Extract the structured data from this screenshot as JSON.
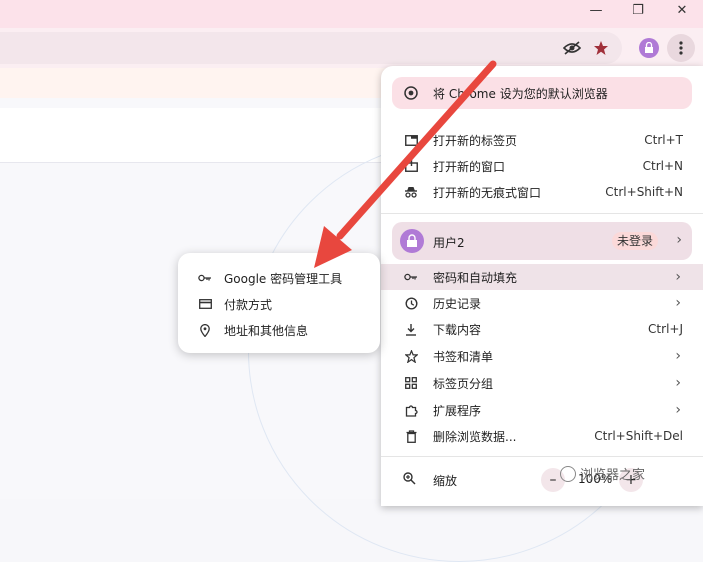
{
  "window": {
    "minimize": "—",
    "maximize": "❐",
    "close": "✕"
  },
  "toolbar": {
    "icons": [
      "eye-off-icon",
      "star-icon",
      "profile-avatar",
      "kebab-icon"
    ]
  },
  "menu": {
    "promo": "将 Chrome 设为您的默认浏览器",
    "new_tab": {
      "label": "打开新的标签页",
      "shortcut": "Ctrl+T"
    },
    "new_window": {
      "label": "打开新的窗口",
      "shortcut": "Ctrl+N"
    },
    "incognito": {
      "label": "打开新的无痕式窗口",
      "shortcut": "Ctrl+Shift+N"
    },
    "profile": {
      "name": "用户2",
      "status": "未登录"
    },
    "passwords": {
      "label": "密码和自动填充"
    },
    "history": {
      "label": "历史记录"
    },
    "downloads": {
      "label": "下载内容",
      "shortcut": "Ctrl+J"
    },
    "bookmarks": {
      "label": "书签和清单"
    },
    "tab_groups": {
      "label": "标签页分组"
    },
    "extensions": {
      "label": "扩展程序"
    },
    "clear_data": {
      "label": "删除浏览数据...",
      "shortcut": "Ctrl+Shift+Del"
    },
    "zoom": {
      "label": "缩放",
      "minus": "–",
      "value": "100%",
      "plus": "+"
    }
  },
  "submenu": {
    "items": [
      {
        "label": "Google 密码管理工具"
      },
      {
        "label": "付款方式"
      },
      {
        "label": "地址和其他信息"
      }
    ]
  },
  "watermark": "浏览器之家",
  "colors": {
    "accent_pink": "#fbe0e6",
    "avatar": "#b07ad6",
    "arrow_red": "#e8473e"
  }
}
